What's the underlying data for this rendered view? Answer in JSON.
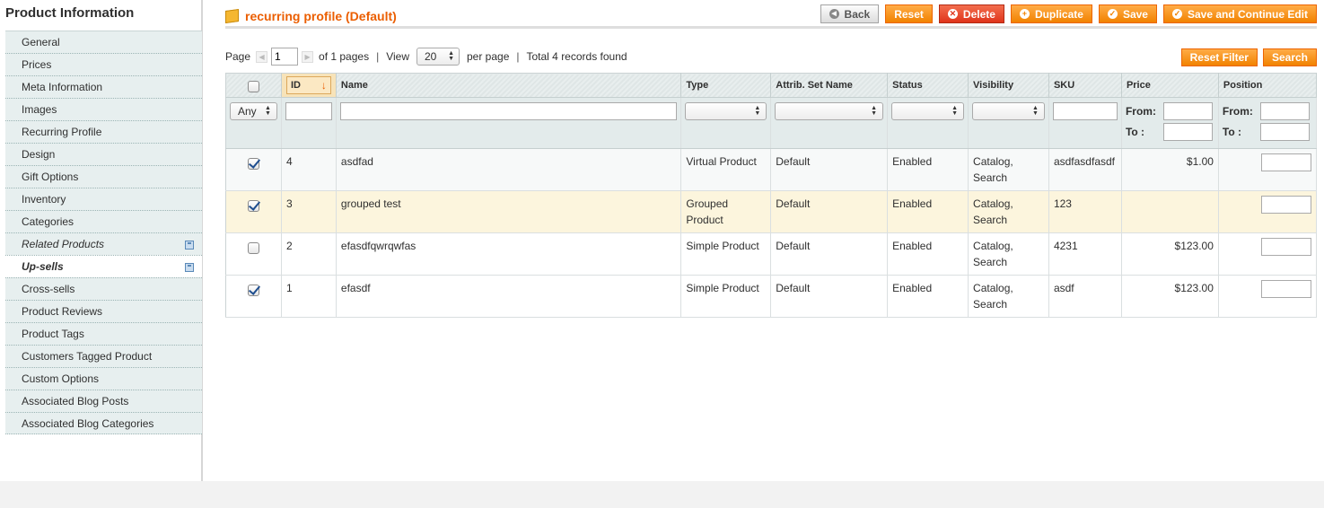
{
  "sidebar": {
    "title": "Product Information",
    "items": [
      {
        "label": "General"
      },
      {
        "label": "Prices"
      },
      {
        "label": "Meta Information"
      },
      {
        "label": "Images"
      },
      {
        "label": "Recurring Profile"
      },
      {
        "label": "Design"
      },
      {
        "label": "Gift Options"
      },
      {
        "label": "Inventory"
      },
      {
        "label": "Categories"
      },
      {
        "label": "Related Products"
      },
      {
        "label": "Up-sells"
      },
      {
        "label": "Cross-sells"
      },
      {
        "label": "Product Reviews"
      },
      {
        "label": "Product Tags"
      },
      {
        "label": "Customers Tagged Product"
      },
      {
        "label": "Custom Options"
      },
      {
        "label": "Associated Blog Posts"
      },
      {
        "label": "Associated Blog Categories"
      }
    ]
  },
  "header": {
    "title": "recurring profile (Default)",
    "buttons": {
      "back": "Back",
      "reset": "Reset",
      "delete": "Delete",
      "duplicate": "Duplicate",
      "save": "Save",
      "save_continue": "Save and Continue Edit"
    }
  },
  "pager": {
    "page_label": "Page",
    "page_value": "1",
    "of_pages": "of 1 pages",
    "sep": "|",
    "view_label": "View",
    "view_value": "20",
    "per_page": "per page",
    "records": "Total 4 records found",
    "reset_filter": "Reset Filter",
    "search": "Search"
  },
  "grid": {
    "columns": {
      "id": "ID",
      "name": "Name",
      "type": "Type",
      "attrib_set": "Attrib. Set Name",
      "status": "Status",
      "visibility": "Visibility",
      "sku": "SKU",
      "price": "Price",
      "position": "Position"
    },
    "filter": {
      "any": "Any",
      "from": "From:",
      "to": "To :"
    },
    "rows": [
      {
        "checked": true,
        "id": "4",
        "name": "asdfad",
        "type": "Virtual Product",
        "attrib_set": "Default",
        "status": "Enabled",
        "visibility": "Catalog, Search",
        "sku": "asdfasdfasdf",
        "price": "$1.00"
      },
      {
        "checked": true,
        "id": "3",
        "name": "grouped test",
        "type": "Grouped Product",
        "attrib_set": "Default",
        "status": "Enabled",
        "visibility": "Catalog, Search",
        "sku": "123",
        "price": ""
      },
      {
        "checked": false,
        "id": "2",
        "name": "efasdfqwrqwfas",
        "type": "Simple Product",
        "attrib_set": "Default",
        "status": "Enabled",
        "visibility": "Catalog, Search",
        "sku": "4231",
        "price": "$123.00"
      },
      {
        "checked": true,
        "id": "1",
        "name": "efasdf",
        "type": "Simple Product",
        "attrib_set": "Default",
        "status": "Enabled",
        "visibility": "Catalog, Search",
        "sku": "asdf",
        "price": "$123.00"
      }
    ]
  }
}
